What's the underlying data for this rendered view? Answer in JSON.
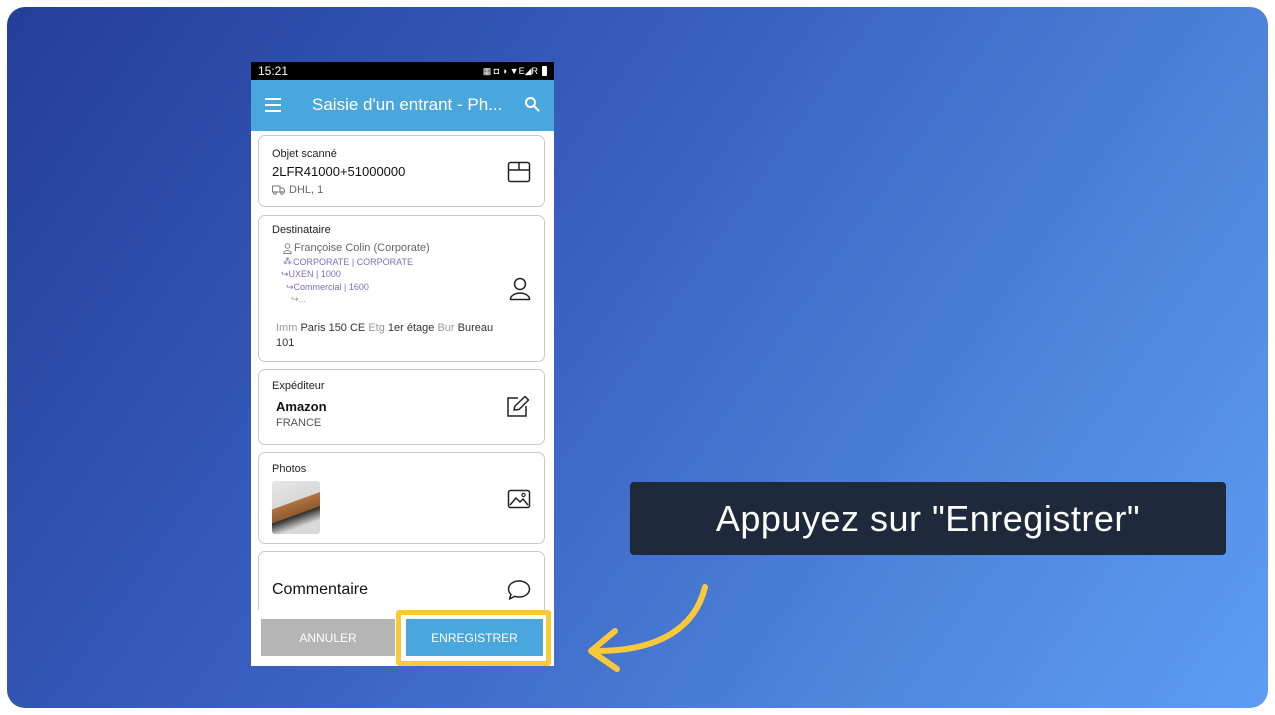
{
  "status_bar": {
    "time": "15:21",
    "icons_text": "▦ ◘ ◑ ▼E◢R"
  },
  "app_bar": {
    "title": "Saisie d'un entrant - Ph..."
  },
  "card_scanned": {
    "label": "Objet scanné",
    "code": "2LFR41000+51000000",
    "carrier": "DHL, 1",
    "icon": "box-icon"
  },
  "card_recipient": {
    "label": "Destinataire",
    "person": "Françoise Colin (Corporate)",
    "org1": "CORPORATE | CORPORATE",
    "org2": "↪UXEN | 1000",
    "org3": "↪Commercial | 1600",
    "org4": "↪...",
    "loc_imm_label": "Imm",
    "loc_imm_value": "Paris 150 CE",
    "loc_etg_label": "Etg",
    "loc_etg_value": "1er étage",
    "loc_bur_label": "Bur",
    "loc_bur_value": "Bureau",
    "loc_line2": "101",
    "icon": "user-icon"
  },
  "card_sender": {
    "label": "Expéditeur",
    "name": "Amazon",
    "country": "FRANCE",
    "icon": "edit-icon"
  },
  "card_photos": {
    "label": "Photos",
    "icon": "image-icon"
  },
  "card_comment": {
    "label": "Commentaire",
    "icon": "chat-bubble-icon"
  },
  "buttons": {
    "cancel": "ANNULER",
    "save": "ENREGISTRER"
  },
  "callout": {
    "text": "Appuyez sur \"Enregistrer\""
  },
  "colors": {
    "accent": "#4aa7dd",
    "highlight": "#f9c93b",
    "callout_bg": "#1e2a3b",
    "purple": "#7c6fbf"
  }
}
